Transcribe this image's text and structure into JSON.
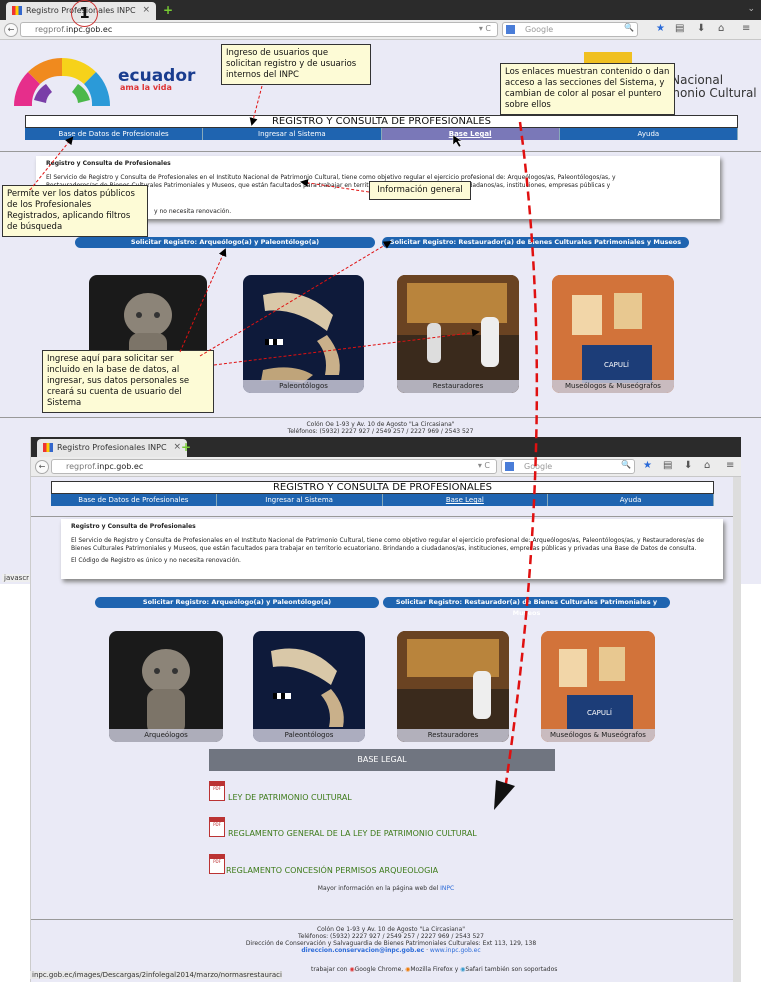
{
  "top_browser": {
    "tab_title": "Registro Profesionales INPC",
    "url_prefix": "regprof.",
    "url_domain": "inpc.gob.ec",
    "search_placeholder": "Google"
  },
  "callout_number": "1",
  "header": {
    "logo_text": "ecuador",
    "logo_sub": "ama la vida",
    "institute_line1": "o Nacional",
    "institute_line2": "rimonio Cultural"
  },
  "page": {
    "title": "REGISTRO Y CONSULTA DE PROFESIONALES",
    "menu": [
      "Base de Datos de Profesionales",
      "Ingresar al Sistema",
      "Base Legal",
      "Ayuda"
    ],
    "info_heading": "Registro y Consulta de Profesionales",
    "info_p1": "El Servicio de Registro y Consulta de Profesionales en el Instituto Nacional de Patrimonio Cultural, tiene como objetivo regular el ejercicio profesional de: Arqueólogos/as, Paleontólogos/as, y Restauradores/as de Bienes Culturales Patrimoniales y Museos, que están facultados para trabajar en territorio ecuatoriano. Brindando a ciudadanos/as, instituciones, empresas públicas y privadas una Base de Datos de consulta.",
    "info_p2": "El Código de Registro es único y no necesita renovación.",
    "info_p1_top_partial": "El Servicio de Registro y Consulta de Profesionales en el Instituto Nacional de Patrimonio Cultural, tiene como objetivo regular el ejercicio profesional de: Arqueólogos/as, Paleontólogos/as, y",
    "info_p1_top_partial2": "Restauradores/as de Bienes Culturales Patrimoniales y Museos, que están facultados para trabajar en territorio ecuatoriano. Brindando a ciudadanos/as, instituciones, empresas públicas y",
    "info_p1_top_partial3": "e consulta.",
    "info_p2_top_partial": "y no necesita renovación.",
    "req_btn_1": "Solicitar Registro: Arqueólogo(a) y Paleontólogo(a)",
    "req_btn_2": "Solicitar Registro: Restaurador(a) de Bienes Culturales Patrimoniales y Museos",
    "cards": [
      "Arqueólogos",
      "Paleontólogos",
      "Restauradores",
      "Museólogos & Museógrafos"
    ],
    "footer_address": "Colón Oe 1-93 y Av. 10 de Agosto \"La Circasiana\"",
    "footer_phones": "Teléfonos: (5932) 2227 927 / 2549 257 / 2227 969 / 2543 527",
    "footer_direction": "Dirección de Conservación y Salvaguardia de Bienes Patrimoniales Culturales: Ext 113, 129, 138",
    "footer_email": "direccion.conservacion@inpc.gob.ec",
    "footer_web": "www.inpc.gob.ec",
    "base_legal_title": "BASE LEGAL",
    "laws": [
      "LEY DE PATRIMONIO CULTURAL",
      "REGLAMENTO GENERAL DE LA LEY DE PATRIMONIO CULTURAL",
      "REGLAMENTO CONCESIÓN PERMISOS ARQUEOLOGIA"
    ],
    "more_info": "Mayor información en la página web del",
    "more_info_link": "INPC",
    "compat_text": "trabajar con",
    "browsers": [
      "Google Chrome,",
      "Mozilla Firefox y",
      "Safari también son soportados"
    ],
    "status_url": "inpc.gob.ec/images/Descargas/2infolegal2014/marzo/normasrestauracion/leypc.pdf",
    "status_js": "javascr"
  },
  "annotations": {
    "ingreso": "Ingreso de usuarios que solicitan registro y de usuarios internos del INPC",
    "enlaces": "Los enlaces muestran contenido o dan acceso a las secciones del Sistema, y cambian de color al posar el puntero sobre ellos",
    "permite": "Permite ver  los datos públicos de los Profesionales Registrados, aplicando filtros de búsqueda",
    "info_general": "Información general",
    "ingrese": "Ingrese aquí para solicitar ser incluido en la base de datos, al ingresar, sus datos personales se creará su cuenta de usuario del Sistema"
  },
  "colors": {
    "menu_blue": "#1f64b0",
    "callout_bg": "#fdfbd6",
    "arrow_red": "#e01010",
    "link_green": "#3c7a18"
  }
}
